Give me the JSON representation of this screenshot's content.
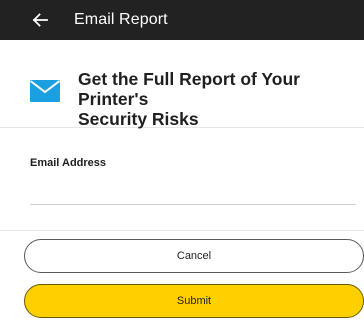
{
  "appbar": {
    "title": "Email Report",
    "back_icon": "arrow-left-icon",
    "background": "#222222"
  },
  "header": {
    "icon": "mail-icon",
    "icon_color": "#1aa0e0",
    "headline": "Get the Full Report of Your Printer's\nSecurity Risks"
  },
  "form": {
    "email_label": "Email Address",
    "email_value": "",
    "email_placeholder": ""
  },
  "actions": {
    "cancel_label": "Cancel",
    "submit_label": "Submit",
    "submit_color": "#ffd000"
  }
}
